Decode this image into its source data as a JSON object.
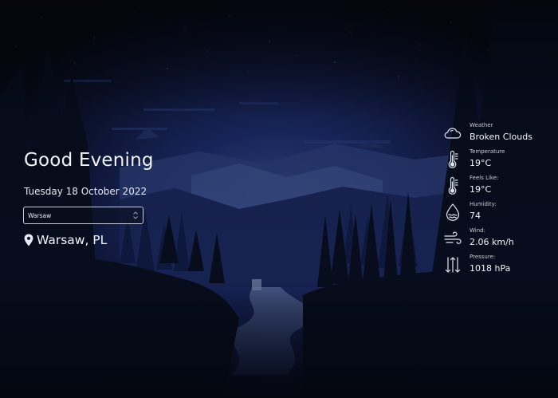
{
  "greeting": "Good Evening",
  "date": "Tuesday 18 October 2022",
  "city_select": {
    "selected": "Warsaw",
    "arrow_icon": "select-arrow-icon"
  },
  "location": {
    "icon": "map-pin-icon",
    "text": "Warsaw, PL"
  },
  "weather_details": [
    {
      "icon": "cloud-icon",
      "label": "Weather",
      "value": "Broken Clouds"
    },
    {
      "icon": "thermometer-icon",
      "label": "Temperature",
      "value": "19°C"
    },
    {
      "icon": "thermometer-icon",
      "label": "Feels Like:",
      "value": "19°C"
    },
    {
      "icon": "humidity-drop-icon",
      "label": "Humidity:",
      "value": "74"
    },
    {
      "icon": "wind-icon",
      "label": "Wind:",
      "value": "2.06 km/h"
    },
    {
      "icon": "pressure-arrows-icon",
      "label": "Pressure:",
      "value": "1018 hPa"
    }
  ],
  "colors": {
    "background": "#070b17",
    "sky": "#1b2f75",
    "text": "#f1f3f8",
    "muted_text": "#c8ccd8"
  }
}
